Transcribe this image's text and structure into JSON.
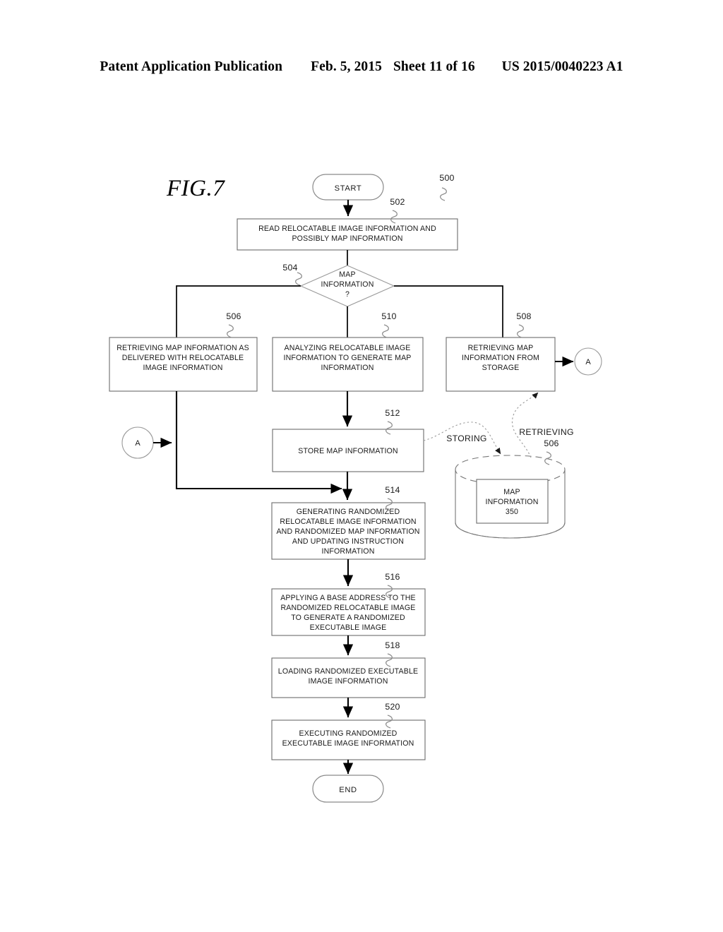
{
  "header": {
    "left": "Patent Application Publication",
    "date": "Feb. 5, 2015",
    "sheet": "Sheet 11 of 16",
    "docnum": "US 2015/0040223 A1"
  },
  "figure": {
    "title": "FIG.7",
    "diagram_ref": "500"
  },
  "nodes": {
    "start": {
      "label": "START"
    },
    "read": {
      "ref": "502",
      "lines": [
        "READ RELOCATABLE IMAGE INFORMATION AND",
        "POSSIBLY MAP INFORMATION"
      ]
    },
    "decision": {
      "ref": "504",
      "lines": [
        "MAP",
        "INFORMATION",
        "?"
      ]
    },
    "retrieve_delivered": {
      "ref": "506",
      "lines": [
        "RETRIEVING MAP INFORMATION AS",
        "DELIVERED WITH RELOCATABLE",
        "IMAGE INFORMATION"
      ]
    },
    "analyze": {
      "ref": "510",
      "lines": [
        "ANALYZING RELOCATABLE IMAGE",
        "INFORMATION TO GENERATE MAP",
        "INFORMATION"
      ]
    },
    "retrieve_storage": {
      "ref": "508",
      "lines": [
        "RETRIEVING MAP",
        "INFORMATION FROM",
        "STORAGE"
      ]
    },
    "store": {
      "ref": "512",
      "lines": [
        "STORE MAP INFORMATION"
      ]
    },
    "generate": {
      "ref": "514",
      "lines": [
        "GENERATING RANDOMIZED",
        "RELOCATABLE IMAGE INFORMATION",
        "AND RANDOMIZED MAP INFORMATION",
        "AND UPDATING INSTRUCTION",
        "INFORMATION"
      ]
    },
    "applying": {
      "ref": "516",
      "lines": [
        "APPLYING A BASE ADDRESS TO THE",
        "RANDOMIZED RELOCATABLE IMAGE",
        "TO GENERATE A RANDOMIZED",
        "EXECUTABLE IMAGE"
      ]
    },
    "loading": {
      "ref": "518",
      "lines": [
        "LOADING RANDOMIZED EXECUTABLE",
        "IMAGE INFORMATION"
      ]
    },
    "executing": {
      "ref": "520",
      "lines": [
        "EXECUTING RANDOMIZED",
        "EXECUTABLE IMAGE INFORMATION"
      ]
    },
    "end": {
      "label": "END"
    },
    "connector_right": {
      "label": "A"
    },
    "connector_left": {
      "label": "A"
    },
    "storage": {
      "ref": "506",
      "lines": [
        "MAP",
        "INFORMATION",
        "350"
      ]
    }
  },
  "annotations": {
    "storing": "STORING",
    "retrieving": "RETRIEVING"
  },
  "colors": {
    "ink": "#000000",
    "outline": "#6b6b6b",
    "paper": "#ffffff"
  }
}
